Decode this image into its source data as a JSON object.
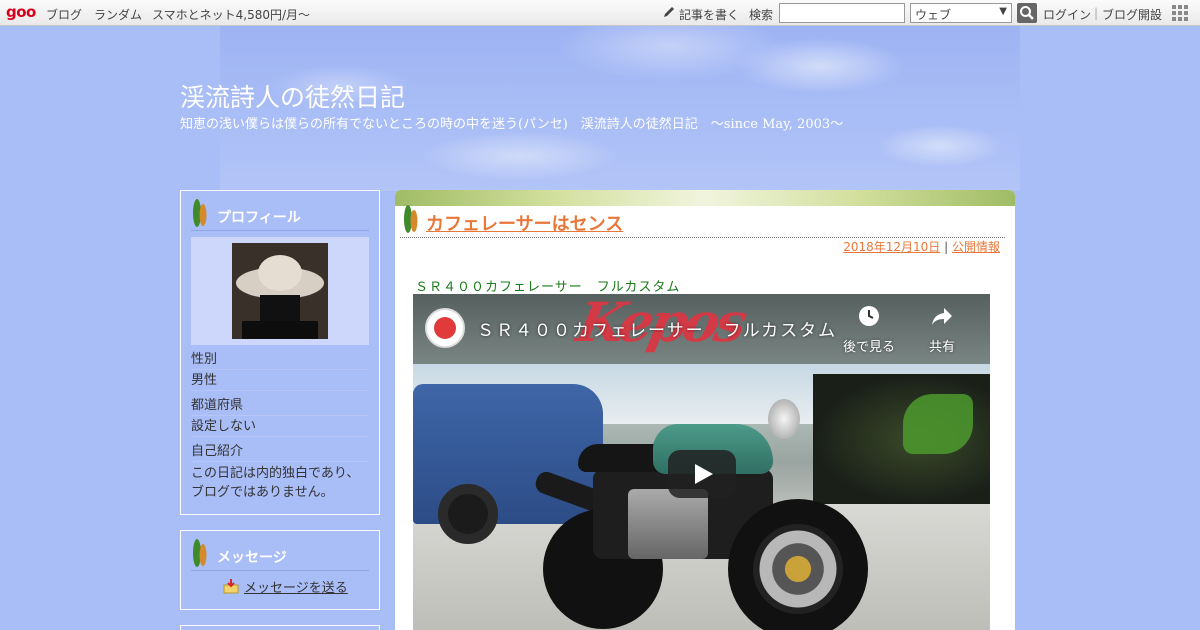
{
  "topbar": {
    "logo": "goo",
    "links": [
      "ブログ",
      "ランダム",
      "スマホとネット4,580円/月～"
    ],
    "write": "記事を書く",
    "search_label": "検索",
    "search_placeholder": "",
    "search_scope": "ウェブ",
    "login": "ログイン",
    "separator": "|",
    "open_blog": "ブログ開設"
  },
  "header": {
    "title": "渓流詩人の徒然日記",
    "description": "知恵の浅い僕らは僕らの所有でないところの時の中を迷う(パンセ)　渓流詩人の徒然日記　～since May, 2003～"
  },
  "profile": {
    "heading": "プロフィール",
    "fields": [
      {
        "label": "性別",
        "value": "男性"
      },
      {
        "label": "都道府県",
        "value": "設定しない"
      },
      {
        "label": "自己紹介",
        "value": "この日記は内的独白であり、ブログではありません。"
      }
    ]
  },
  "message": {
    "heading": "メッセージ",
    "link": "メッセージを送る"
  },
  "post": {
    "title": "カフェレーサーはセンス",
    "date": "2018年12月10日",
    "meta_separator": " | ",
    "visibility": "公開情報",
    "subtitle": "ＳＲ４００カフェレーサー　フルカスタム"
  },
  "video": {
    "title": "ＳＲ４００カフェレーサー　フルカスタム",
    "watch_later": "後で見る",
    "share": "共有",
    "sign_text": "Kepos"
  },
  "colors": {
    "background": "#a9bdf7",
    "link": "#e8783a",
    "subtitle": "#1a7a1a"
  }
}
